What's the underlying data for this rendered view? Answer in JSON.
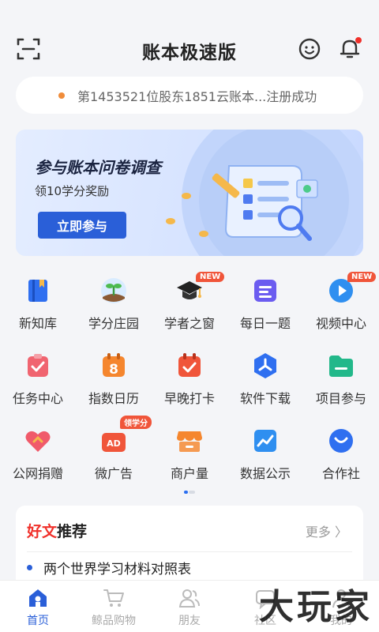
{
  "header": {
    "title": "账本极速版"
  },
  "ticker": {
    "text": "第1453521位股东1851云账本...注册成功"
  },
  "banner": {
    "title": "参与账本问卷调查",
    "subtitle": "领10学分奖励",
    "button": "立即参与"
  },
  "grid": [
    {
      "label": "新知库",
      "icon": "book-icon",
      "badge": ""
    },
    {
      "label": "学分庄园",
      "icon": "sprout-icon",
      "badge": ""
    },
    {
      "label": "学者之窗",
      "icon": "graduation-cap-icon",
      "badge": "NEW"
    },
    {
      "label": "每日一题",
      "icon": "document-icon",
      "badge": ""
    },
    {
      "label": "视频中心",
      "icon": "play-icon",
      "badge": "NEW"
    },
    {
      "label": "任务中心",
      "icon": "task-icon",
      "badge": ""
    },
    {
      "label": "指数日历",
      "icon": "calendar-icon",
      "badge": ""
    },
    {
      "label": "早晚打卡",
      "icon": "checkin-icon",
      "badge": ""
    },
    {
      "label": "软件下载",
      "icon": "hexagon-icon",
      "badge": ""
    },
    {
      "label": "项目参与",
      "icon": "folder-icon",
      "badge": ""
    },
    {
      "label": "公网捐赠",
      "icon": "heart-icon",
      "badge": ""
    },
    {
      "label": "微广告",
      "icon": "ad-icon",
      "badge": "领学分"
    },
    {
      "label": "商户量",
      "icon": "store-icon",
      "badge": ""
    },
    {
      "label": "数据公示",
      "icon": "chart-icon",
      "badge": ""
    },
    {
      "label": "合作社",
      "icon": "coop-icon",
      "badge": ""
    }
  ],
  "articles": {
    "title_red": "好文",
    "title_rest": "推荐",
    "more": "更多 〉",
    "items": [
      "两个世界学习材料对照表"
    ]
  },
  "tabs": [
    {
      "label": "首页",
      "icon": "home-icon",
      "active": true
    },
    {
      "label": "鲸品购物",
      "icon": "cart-icon",
      "active": false
    },
    {
      "label": "朋友",
      "icon": "friends-icon",
      "active": false
    },
    {
      "label": "社区",
      "icon": "community-icon",
      "active": false
    },
    {
      "label": "我的",
      "icon": "profile-icon",
      "active": false
    }
  ],
  "watermark": "大玩家",
  "colors": {
    "accent": "#2a5fd8",
    "badge": "#f0553a",
    "red_title": "#f0302a"
  }
}
